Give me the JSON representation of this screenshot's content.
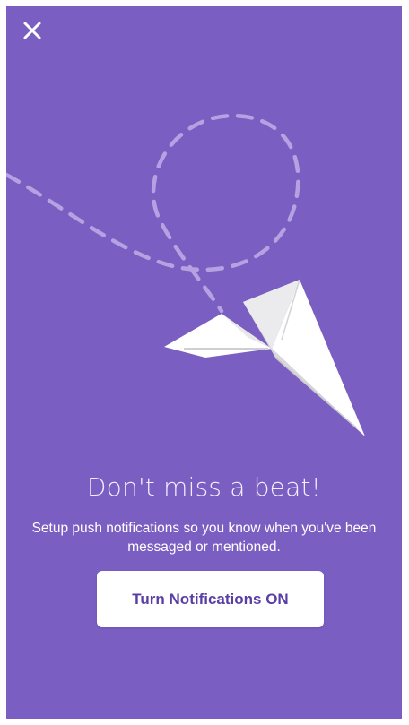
{
  "colors": {
    "background": "#7b5ec1",
    "button_bg": "#ffffff",
    "button_text": "#5a3ea6",
    "dashed_trail": "#b4a2e2"
  },
  "icons": {
    "close": "close-icon",
    "illustration": "paper-plane-icon"
  },
  "onboarding": {
    "headline": "Don't miss a beat!",
    "description": "Setup push notifications so you know when you've been messaged or mentioned.",
    "cta_label": "Turn Notifications ON"
  }
}
